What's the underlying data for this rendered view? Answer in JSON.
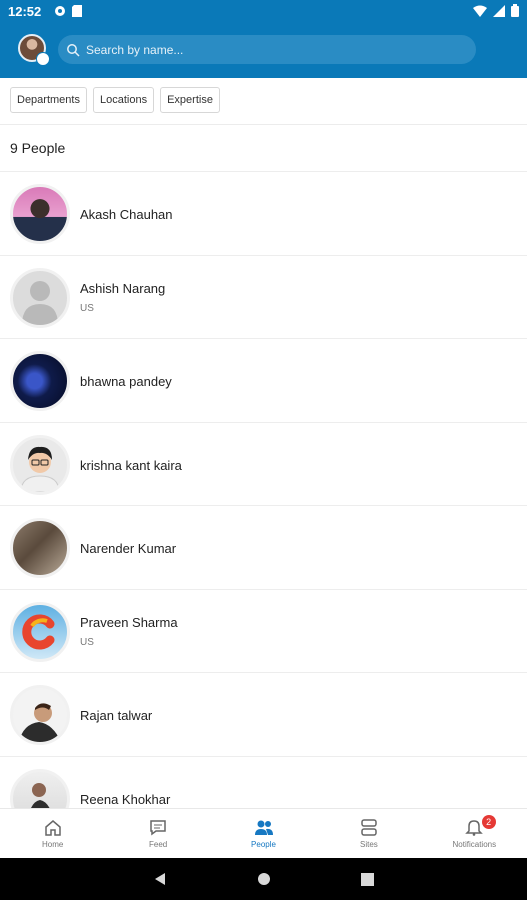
{
  "status": {
    "time": "12:52"
  },
  "search": {
    "placeholder": "Search by name..."
  },
  "filters": [
    "Departments",
    "Locations",
    "Expertise"
  ],
  "people_count": "9 People",
  "people": [
    {
      "name": "Akash Chauhan",
      "sub": ""
    },
    {
      "name": "Ashish Narang",
      "sub": "US"
    },
    {
      "name": "bhawna pandey",
      "sub": ""
    },
    {
      "name": "krishna kant kaira",
      "sub": ""
    },
    {
      "name": "Narender Kumar",
      "sub": ""
    },
    {
      "name": "Praveen Sharma",
      "sub": "US"
    },
    {
      "name": "Rajan talwar",
      "sub": ""
    },
    {
      "name": "Reena Khokhar",
      "sub": ""
    }
  ],
  "nav": {
    "home": "Home",
    "feed": "Feed",
    "people": "People",
    "sites": "Sites",
    "notifications": "Notifications",
    "notifications_badge": "2"
  },
  "colors": {
    "brand": "#0a79b8",
    "active": "#1678c2",
    "badge": "#e53935"
  }
}
